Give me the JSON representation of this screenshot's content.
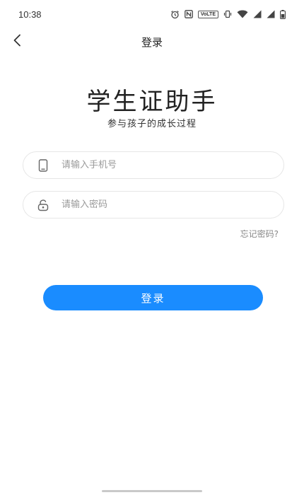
{
  "status_bar": {
    "time": "10:38",
    "volte": "VoLTE",
    "icons": [
      "alarm-icon",
      "nfc-icon",
      "volte-icon",
      "vibrate-icon",
      "wifi-icon",
      "signal-icon",
      "signal-icon",
      "battery-icon"
    ]
  },
  "nav": {
    "back_icon": "chevron-left-icon",
    "title": "登录"
  },
  "app": {
    "title": "学生证助手",
    "subtitle": "参与孩子的成长过程"
  },
  "form": {
    "phone": {
      "icon": "phone-icon",
      "placeholder": "请输入手机号",
      "value": ""
    },
    "password": {
      "icon": "lock-icon",
      "placeholder": "请输入密码",
      "value": ""
    },
    "forgot_label": "忘记密码?",
    "submit_label": "登录"
  },
  "colors": {
    "primary": "#1a8cff",
    "background": "#ffffff",
    "placeholder": "#9a9a9a",
    "field_border": "#e6e6e6"
  }
}
